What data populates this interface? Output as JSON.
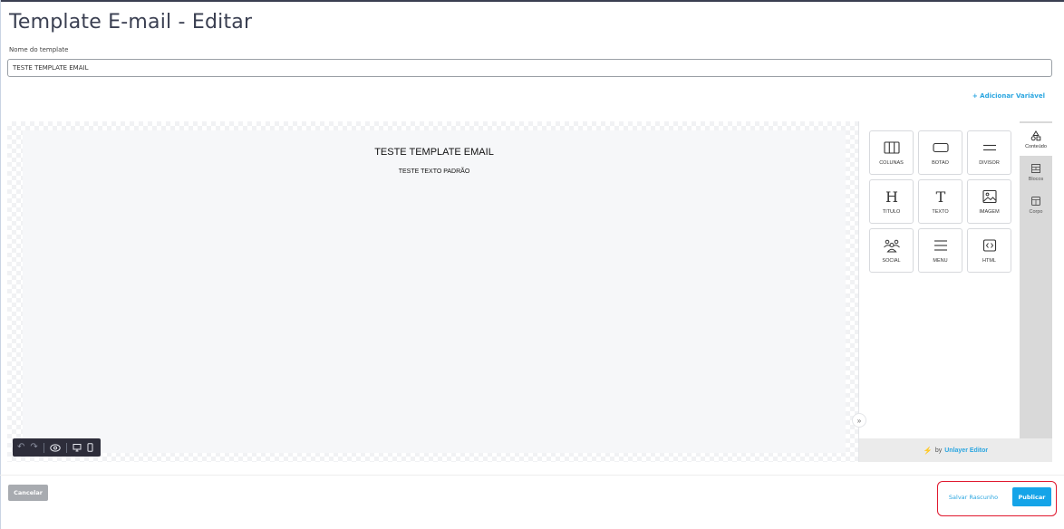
{
  "page": {
    "title": "Template E-mail - Editar"
  },
  "form": {
    "name_label": "Nome do template",
    "name_value": "TESTE TEMPLATE EMAIL",
    "add_variable": "+ Adicionar Variável"
  },
  "canvas": {
    "heading": "TESTE TEMPLATE EMAIL",
    "body_text": "TESTE TEXTO PADRÃO"
  },
  "toolbar": {
    "icons": [
      "undo-icon",
      "redo-icon",
      "preview-eye-icon",
      "desktop-icon",
      "mobile-icon"
    ]
  },
  "tools": [
    {
      "label": "COLUNAS",
      "icon": "columns-icon"
    },
    {
      "label": "BOTAO",
      "icon": "button-icon"
    },
    {
      "label": "DIVISOR",
      "icon": "divider-icon"
    },
    {
      "label": "TITULO",
      "icon": "heading-icon"
    },
    {
      "label": "TEXTO",
      "icon": "text-icon"
    },
    {
      "label": "IMAGEM",
      "icon": "image-icon"
    },
    {
      "label": "SOCIAL",
      "icon": "social-icon"
    },
    {
      "label": "MENU",
      "icon": "menu-icon"
    },
    {
      "label": "HTML",
      "icon": "html-icon"
    }
  ],
  "tabs": [
    {
      "label": "Conteúdo",
      "icon": "content-icon",
      "active": true
    },
    {
      "label": "Blocos",
      "icon": "blocks-icon",
      "active": false
    },
    {
      "label": "Corpo",
      "icon": "body-icon",
      "active": false
    }
  ],
  "powered": {
    "prefix": "by",
    "brand": "Unlayer Editor"
  },
  "actions": {
    "cancel": "Cancelar",
    "save_draft": "Salvar Rascunho",
    "publish": "Publicar"
  },
  "colors": {
    "accent": "#2ba6e0",
    "publish_bg": "#15a4e8",
    "highlight_border": "#e0182e",
    "cancel_bg": "#a8abb0"
  }
}
